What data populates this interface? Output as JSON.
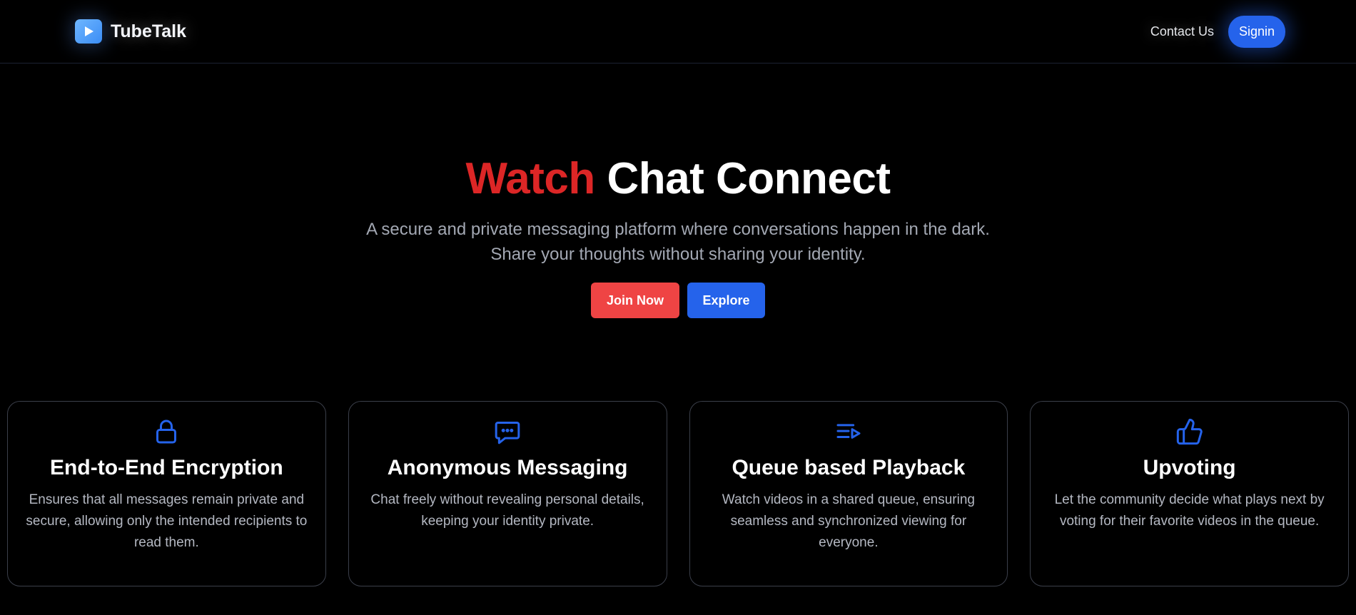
{
  "brand": {
    "name": "TubeTalk",
    "icon": "play-icon"
  },
  "nav": {
    "contact_label": "Contact Us",
    "signin_label": "Signin"
  },
  "hero": {
    "title_accent": "Watch",
    "title_rest": "Chat Connect",
    "subtitle_line1": "A secure and private messaging platform where conversations happen in the dark.",
    "subtitle_line2": "Share your thoughts without sharing your identity.",
    "join_label": "Join Now",
    "explore_label": "Explore"
  },
  "features": [
    {
      "icon": "lock-icon",
      "title": "End-to-End Encryption",
      "description": "Ensures that all messages remain private and secure, allowing only the intended recipients to read them."
    },
    {
      "icon": "message-icon",
      "title": "Anonymous Messaging",
      "description": "Chat freely without revealing personal details, keeping your identity private."
    },
    {
      "icon": "queue-icon",
      "title": "Queue based Playback",
      "description": "Watch videos in a shared queue, ensuring seamless and synchronized viewing for everyone."
    },
    {
      "icon": "thumbs-up-icon",
      "title": "Upvoting",
      "description": "Let the community decide what plays next by voting for their favorite videos in the queue."
    }
  ],
  "colors": {
    "accent_red": "#dc2626",
    "button_red": "#ef4444",
    "accent_blue": "#2563eb",
    "background": "#000000"
  }
}
